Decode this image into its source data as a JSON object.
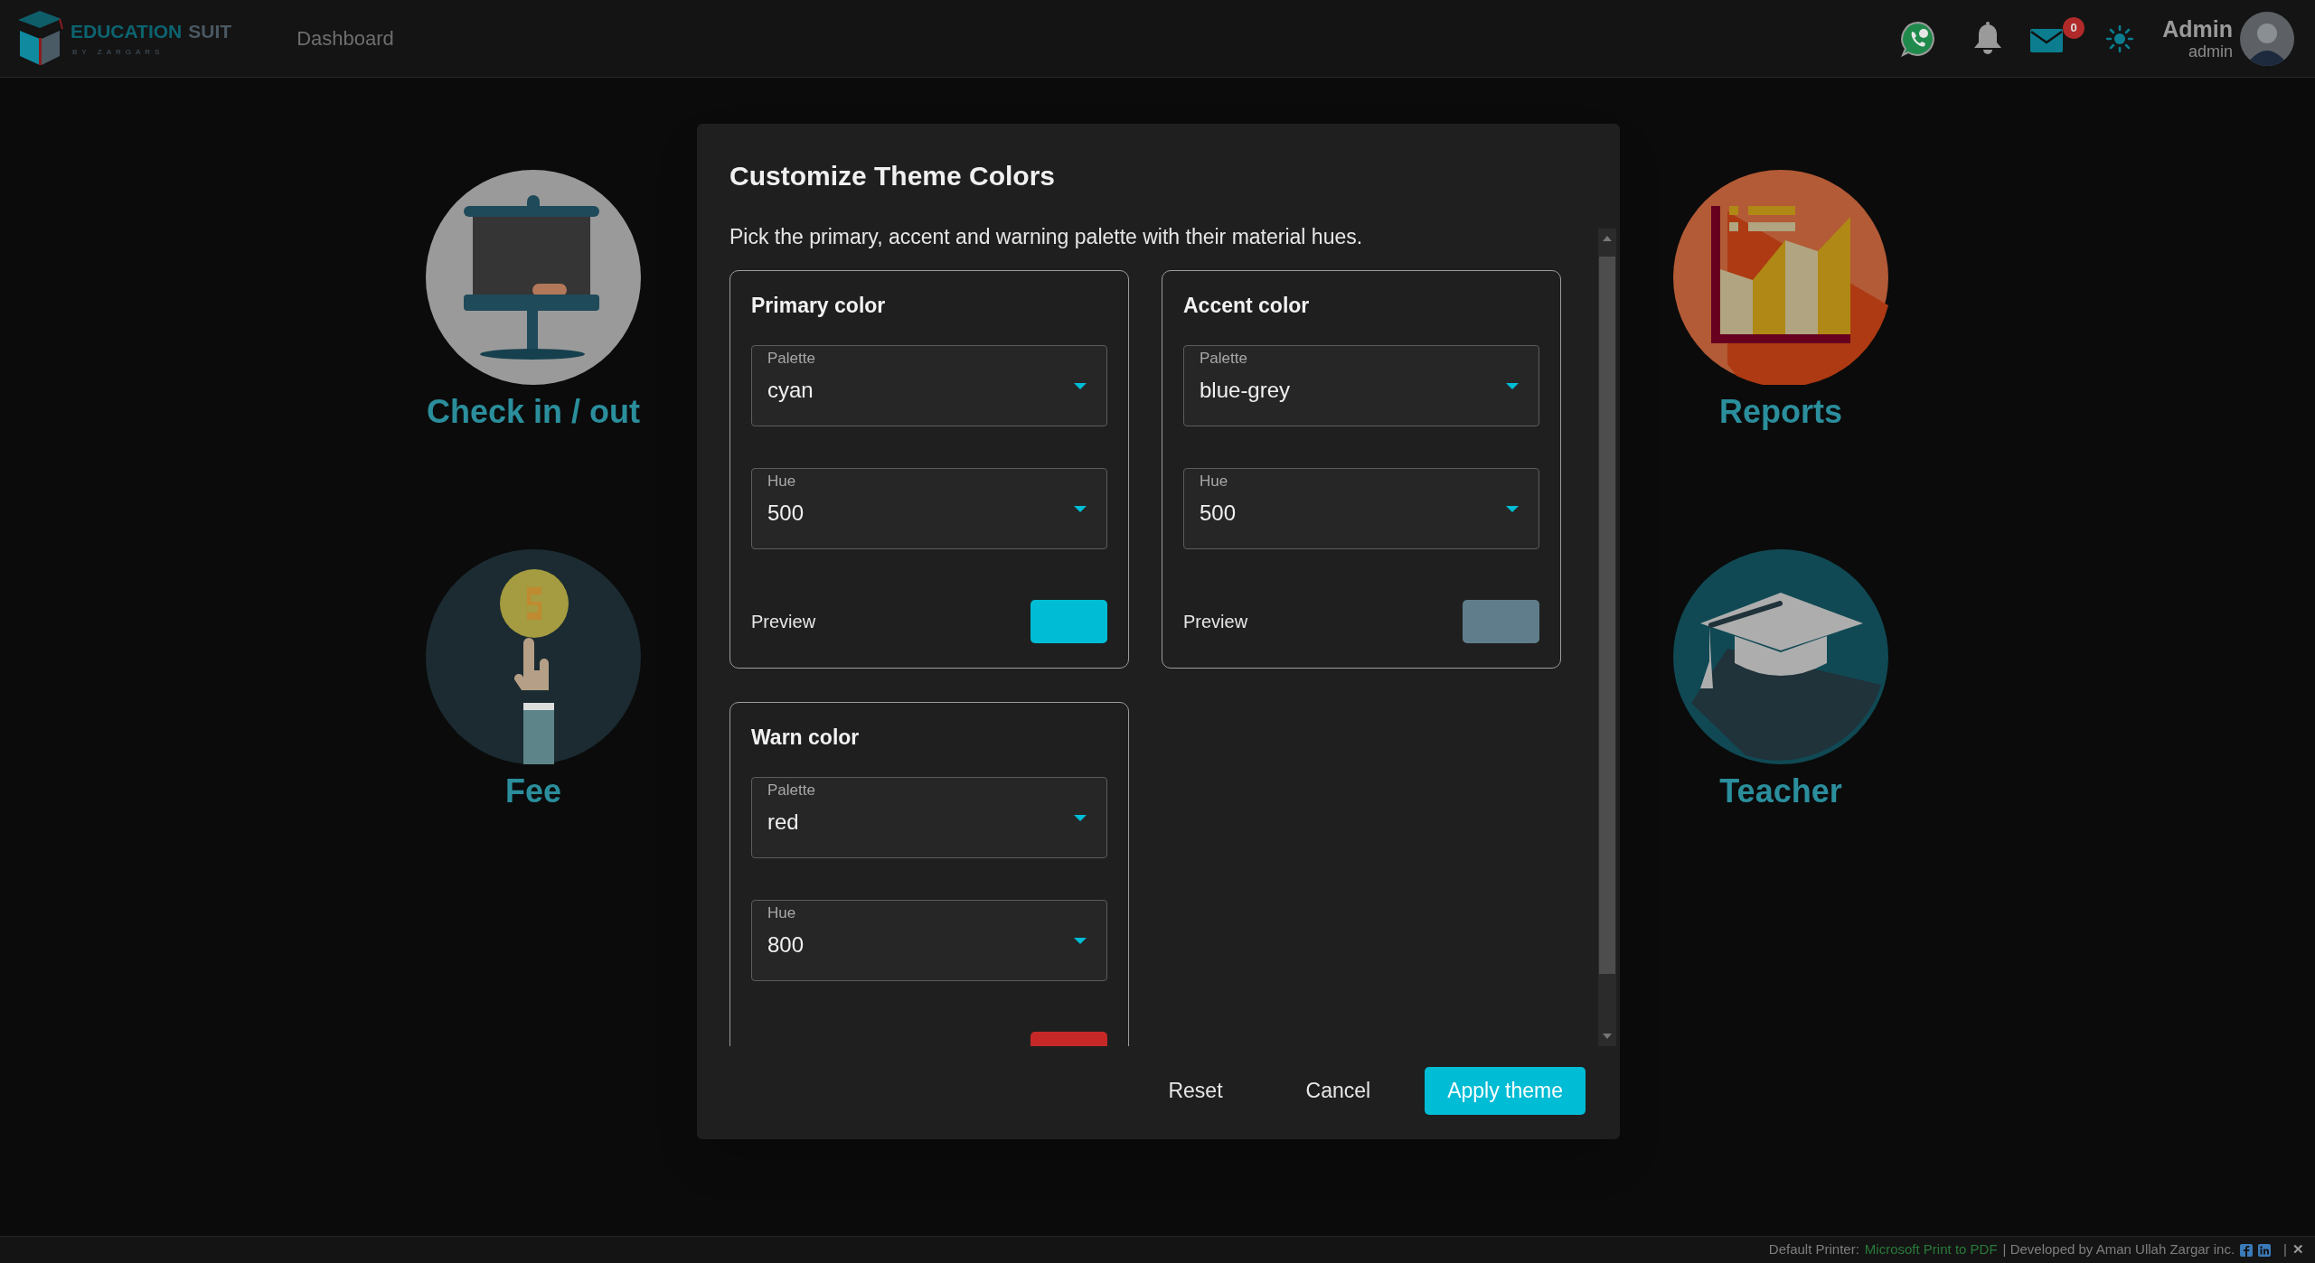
{
  "header": {
    "brand": {
      "name": "EDUCATION",
      "name_suffix": "SUIT",
      "tagline": "BY ZARGARS"
    },
    "nav": [
      {
        "label": "Dashboard"
      }
    ],
    "mail_count": "0",
    "user": {
      "name": "Admin",
      "role": "admin"
    }
  },
  "tiles": [
    {
      "label": "Check in / out",
      "kind": "board"
    },
    {
      "label": "Reports",
      "kind": "chart"
    },
    {
      "label": "Fee",
      "kind": "fee"
    },
    {
      "label": "Teacher",
      "kind": "cap"
    }
  ],
  "dialog": {
    "title": "Customize Theme Colors",
    "subtitle": "Pick the primary, accent and warning palette with their material hues.",
    "cards": [
      {
        "title": "Primary color",
        "fields": [
          {
            "label": "Palette",
            "value": "cyan"
          },
          {
            "label": "Hue",
            "value": "500"
          }
        ],
        "preview_label": "Preview",
        "color": "#00bcd4"
      },
      {
        "title": "Accent color",
        "fields": [
          {
            "label": "Palette",
            "value": "blue-grey"
          },
          {
            "label": "Hue",
            "value": "500"
          }
        ],
        "preview_label": "Preview",
        "color": "#607d8b"
      },
      {
        "title": "Warn color",
        "fields": [
          {
            "label": "Palette",
            "value": "red"
          },
          {
            "label": "Hue",
            "value": "800"
          }
        ],
        "color": "#c62828"
      }
    ],
    "buttons": [
      {
        "label": "Reset",
        "kind": "text"
      },
      {
        "label": "Cancel",
        "kind": "text"
      },
      {
        "label": "Apply theme",
        "kind": "primary"
      }
    ]
  },
  "footer": {
    "printer_label": "Default Printer:",
    "printer": "Microsoft Print to PDF",
    "credit": "| Developed by Aman Ullah Zargar inc.",
    "separator": "|",
    "close": "✕"
  }
}
